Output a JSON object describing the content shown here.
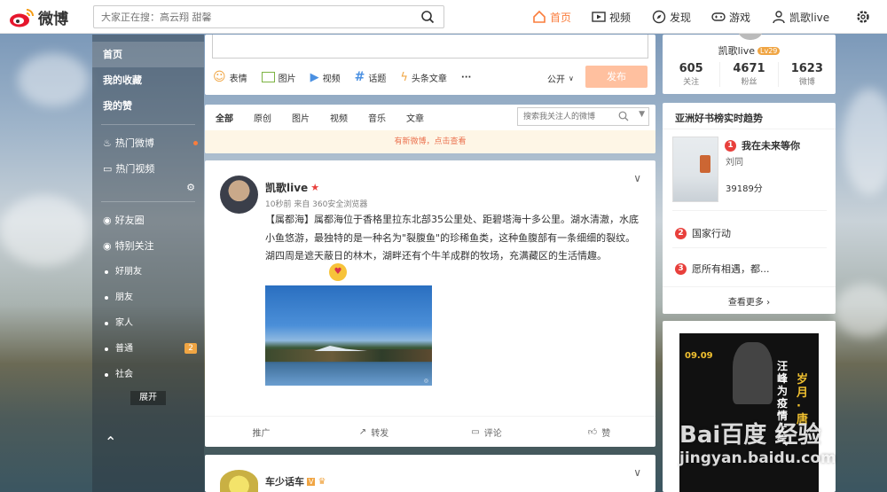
{
  "topbar": {
    "logo_text": "微博",
    "search_placeholder": "大家正在搜：高云翔 甜馨",
    "nav": {
      "home": "首页",
      "video": "视频",
      "discover": "发现",
      "games": "游戏",
      "user": "凯歌live"
    }
  },
  "sidebar": {
    "top_items": [
      "首页",
      "我的收藏",
      "我的赞"
    ],
    "hot_items": [
      "热门微博",
      "热门视频"
    ],
    "groups": [
      "好友圈",
      "特别关注"
    ],
    "sub_items": [
      "好朋友",
      "朋友",
      "家人",
      "普通",
      "社会"
    ],
    "sub_badge": "2",
    "expand": "展开"
  },
  "composer": {
    "tools": [
      "表情",
      "图片",
      "视频",
      "话题",
      "头条文章"
    ],
    "more": "···",
    "visibility": "公开",
    "publish": "发布"
  },
  "feed_tabs": {
    "tabs": [
      "全部",
      "原创",
      "图片",
      "视频",
      "音乐",
      "文章"
    ],
    "search_placeholder": "搜索我关注人的微博",
    "new_notice": "有新微博，点击查看"
  },
  "post": {
    "author": "凯歌live",
    "meta": "10秒前 来自 360安全浏览器",
    "text": "【属都海】属都海位于香格里拉东北部35公里处、距碧塔海十多公里。湖水清澈，水底小鱼悠游，最独特的是一种名为\"裂腹鱼\"的珍稀鱼类，这种鱼腹部有一条细细的裂纹。湖四周是遮天蔽日的林木，湖畔还有个牛羊成群的牧场，充满藏区的生活情趣。",
    "actions": [
      "推广",
      "转发",
      "评论",
      "赞"
    ]
  },
  "post2": {
    "author": "车少话车"
  },
  "profile": {
    "name": "凯歌live",
    "level": "Lv29",
    "stats": [
      {
        "value": "605",
        "label": "关注"
      },
      {
        "value": "4671",
        "label": "粉丝"
      },
      {
        "value": "1623",
        "label": "微博"
      }
    ]
  },
  "hot": {
    "title": "亚洲好书榜实时趋势",
    "featured": {
      "rank": "1",
      "title": "我在未来等你",
      "author": "刘同",
      "count": "39189分"
    },
    "items": [
      {
        "rank": "2",
        "title": "国家行动"
      },
      {
        "rank": "3",
        "title": "愿所有相遇，都..."
      }
    ],
    "more": "查看更多 ›"
  },
  "ad": {
    "date": "09.09",
    "line1": "汪峰为疫情上气",
    "line2": "岁月·唐"
  },
  "watermark": {
    "brand": "Bai百度 经验",
    "url": "jingyan.baidu.com"
  },
  "colors": {
    "accent": "#fa7d3c",
    "publish": "#ffc09f",
    "rank": "#e8403c",
    "link": "#eb7350"
  }
}
